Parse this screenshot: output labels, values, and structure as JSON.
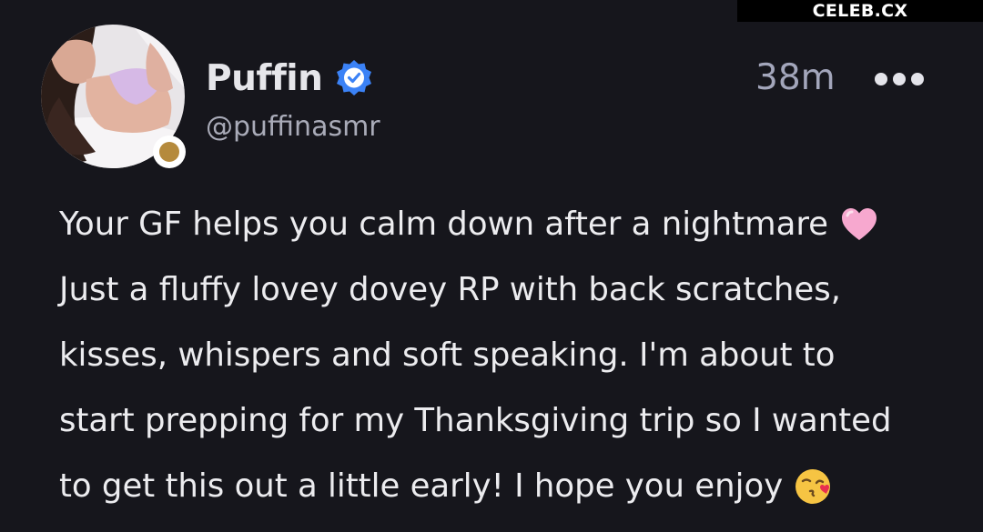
{
  "watermark": {
    "text": "CELEB.CX"
  },
  "post": {
    "author": {
      "display_name": "Puffin",
      "handle": "@puffinasmr",
      "verified": true
    },
    "time_ago": "38m",
    "text_lines": [
      "Your GF helps you calm down after a nightmare",
      "Just a fluffy lovey dovey RP with back scratches,",
      "kisses, whispers and soft speaking. I'm about to",
      "start prepping for my Thanksgiving trip so I wanted",
      "to get this out a little early! I hope you enjoy"
    ],
    "emojis": {
      "line_0": "pink-heart-emoji",
      "line_4": "face-blowing-kiss-emoji"
    }
  },
  "colors": {
    "background": "#16161c",
    "verified_badge": "#3b82f6",
    "status_dot": "#b58a3c"
  }
}
